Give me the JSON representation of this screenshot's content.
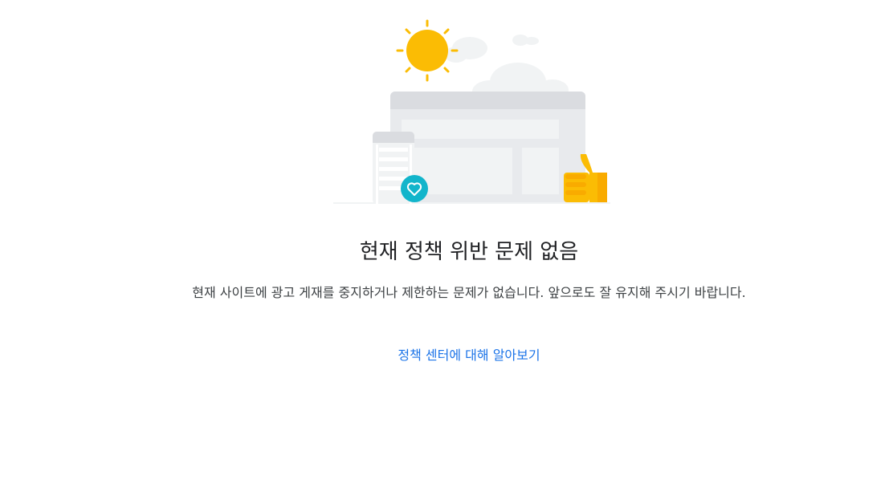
{
  "empty_state": {
    "title": "현재 정책 위반 문제 없음",
    "description": "현재 사이트에 광고 게재를 중지하거나 제한하는 문제가 없습니다. 앞으로도 잘 유지해 주시기 바랍니다.",
    "link_label": "정책 센터에 대해 알아보기"
  },
  "illustration": {
    "icons": [
      "sun-icon",
      "cloud-icon",
      "browser-window-icon",
      "mobile-phone-icon",
      "heart-icon",
      "thumbs-up-icon"
    ]
  },
  "colors": {
    "title_text": "#202124",
    "body_text": "#3c4043",
    "link": "#1a73e8",
    "sun": "#fbbc04",
    "heart_badge": "#12b5cb",
    "window_gray": "#dadce0"
  }
}
